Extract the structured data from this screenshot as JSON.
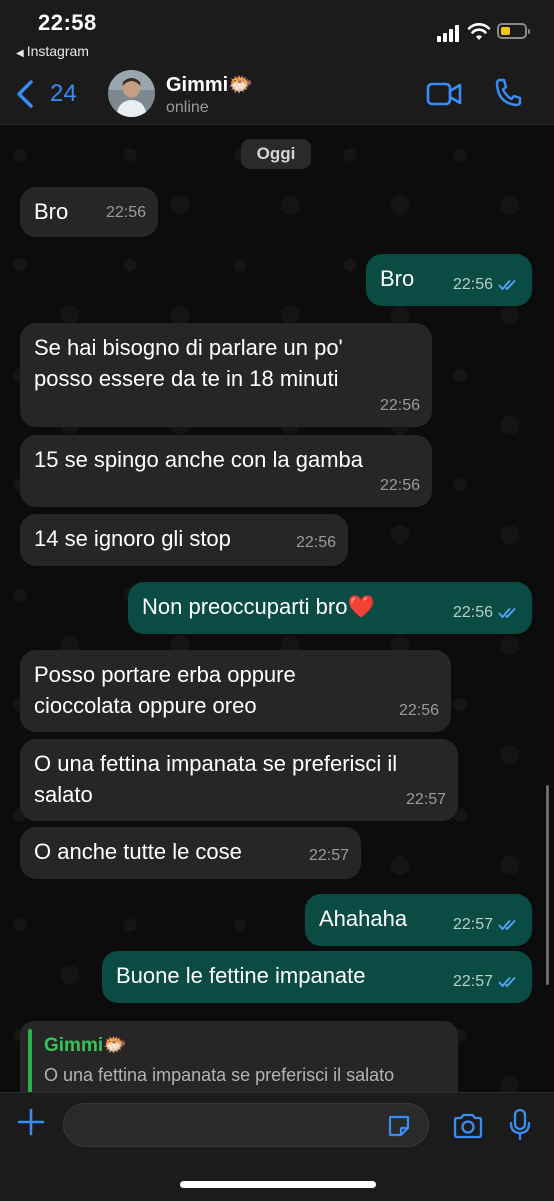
{
  "status_bar": {
    "time": "22:58",
    "back_app": "Instagram"
  },
  "header": {
    "back_count": "24",
    "contact_name": "Gimmi🐡",
    "contact_status": "online"
  },
  "chat": {
    "date_label": "Oggi",
    "messages": [
      {
        "dir": "in",
        "text": "Bro",
        "time": "22:56"
      },
      {
        "dir": "out",
        "text": "Bro",
        "time": "22:56",
        "read": true
      },
      {
        "dir": "in",
        "text": "Se hai bisogno di parlare un po' posso essere da te in 18 minuti",
        "time": "22:56"
      },
      {
        "dir": "in",
        "text": "15 se spingo anche con la gamba",
        "time": "22:56"
      },
      {
        "dir": "in",
        "text": "14 se ignoro gli stop",
        "time": "22:56"
      },
      {
        "dir": "out",
        "text": "Non preoccuparti bro❤️",
        "time": "22:56",
        "read": true
      },
      {
        "dir": "in",
        "text": "Posso portare erba oppure cioccolata oppure oreo",
        "time": "22:56"
      },
      {
        "dir": "in",
        "text": "O una fettina impanata se preferisci il salato",
        "time": "22:57"
      },
      {
        "dir": "in",
        "text": "O anche tutte le cose",
        "time": "22:57"
      },
      {
        "dir": "out",
        "text": "Ahahaha",
        "time": "22:57",
        "read": true
      },
      {
        "dir": "out",
        "text": "Buone le fettine impanate",
        "time": "22:57",
        "read": true
      }
    ],
    "reply_preview": {
      "name": "Gimmi🐡",
      "text": "O una fettina impanata se preferisci il salato"
    }
  },
  "composer": {
    "value": "",
    "placeholder": ""
  },
  "colors": {
    "accent": "#3a8df5",
    "incoming_bubble": "#262626",
    "outgoing_bubble": "#0a4b43",
    "read_ticks": "#53a6fa",
    "reply_name": "#35c45a"
  },
  "icons": [
    "back-chevron-icon",
    "video-call-icon",
    "phone-icon",
    "plus-icon",
    "sticker-icon",
    "camera-icon",
    "microphone-icon"
  ]
}
